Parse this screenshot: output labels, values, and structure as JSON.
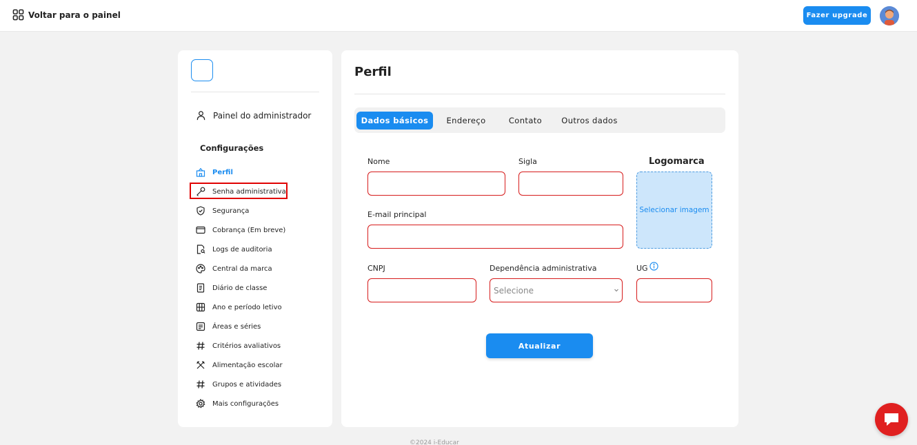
{
  "topbar": {
    "back_label": "Voltar para o painel",
    "upgrade_label": "Fazer upgrade"
  },
  "sidebar": {
    "admin_panel_label": "Painel do administrador",
    "config_title": "Configurações",
    "items": [
      {
        "label": "Perfil",
        "icon": "building-icon",
        "active": true
      },
      {
        "label": "Senha administrativa",
        "icon": "key-icon",
        "highlighted": true
      },
      {
        "label": "Segurança",
        "icon": "shield-icon"
      },
      {
        "label": "Cobrança (Em breve)",
        "icon": "credit-card-icon"
      },
      {
        "label": "Logs de auditoria",
        "icon": "document-search-icon"
      },
      {
        "label": "Central da marca",
        "icon": "palette-icon"
      },
      {
        "label": "Diário de classe",
        "icon": "notebook-icon"
      },
      {
        "label": "Ano e período letivo",
        "icon": "calendar-icon"
      },
      {
        "label": "Áreas e séries",
        "icon": "list-icon"
      },
      {
        "label": "Critérios avaliativos",
        "icon": "hash-icon"
      },
      {
        "label": "Alimentação escolar",
        "icon": "utensils-icon"
      },
      {
        "label": "Grupos e atividades",
        "icon": "hash-icon"
      },
      {
        "label": "Mais configurações",
        "icon": "gear-icon"
      }
    ]
  },
  "main": {
    "title": "Perfil",
    "tabs": [
      {
        "label": "Dados básicos",
        "active": true
      },
      {
        "label": "Endereço"
      },
      {
        "label": "Contato"
      },
      {
        "label": "Outros dados"
      }
    ],
    "form": {
      "nome_label": "Nome",
      "sigla_label": "Sigla",
      "email_label": "E-mail principal",
      "cnpj_label": "CNPJ",
      "dependencia_label": "Dependência administrativa",
      "dependencia_value": "Selecione",
      "ug_label": "UG",
      "logo_title": "Logomarca",
      "logo_action": "Selecionar imagem",
      "submit_label": "Atualizar"
    }
  },
  "footer": {
    "text": "©2024 i-Educar"
  },
  "colors": {
    "accent": "#1a8cf0",
    "error_border": "#d61a1a",
    "chat": "#e02020"
  }
}
